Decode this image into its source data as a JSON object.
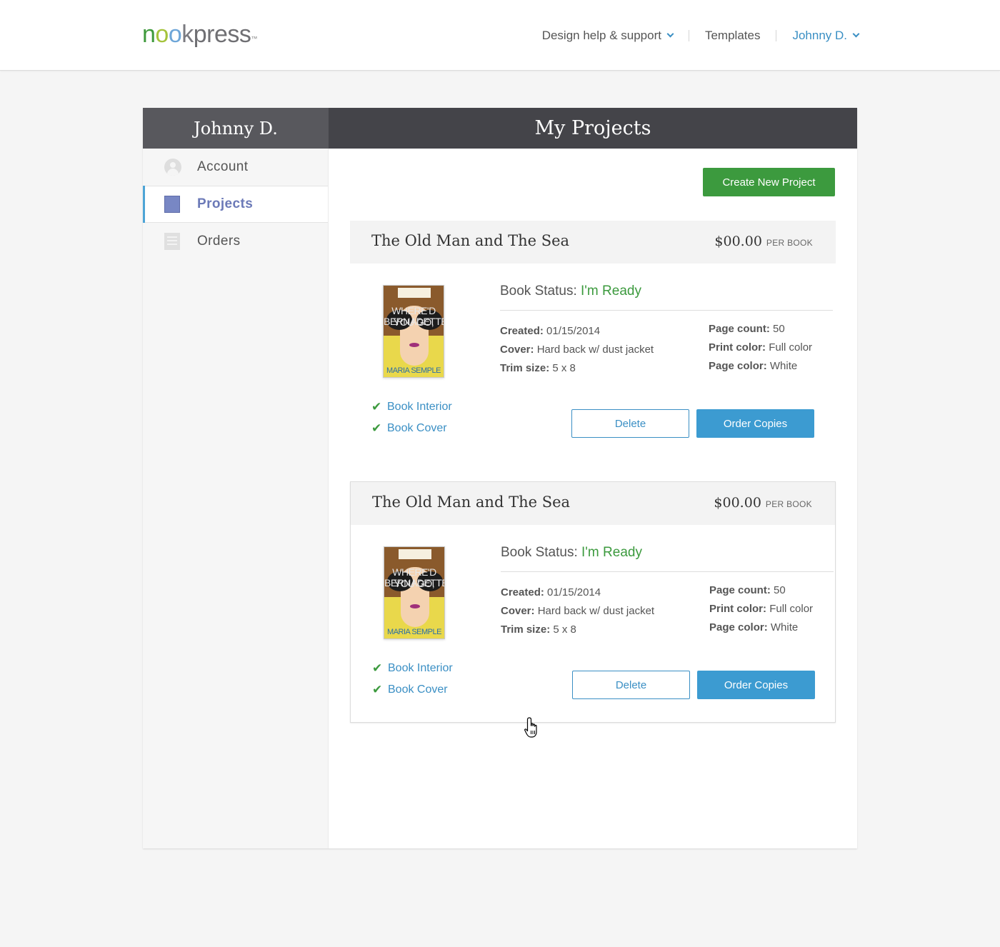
{
  "header": {
    "logo": {
      "nook_n": "n",
      "nook_o1": "o",
      "nook_o2": "o",
      "nook_k": "k",
      "press": "press",
      "tm": "™"
    },
    "nav": {
      "help_label": "Design help & support",
      "templates_label": "Templates",
      "user_label": "Johnny D."
    }
  },
  "sidebar": {
    "user_name": "Johnny D.",
    "items": [
      {
        "label": "Account",
        "icon": "user-icon"
      },
      {
        "label": "Projects",
        "icon": "book-icon",
        "active": true
      },
      {
        "label": "Orders",
        "icon": "receipt-icon"
      }
    ]
  },
  "main": {
    "title": "My Projects",
    "create_button": "Create New Project",
    "projects": [
      {
        "title": "The Old Man and The Sea",
        "price": "$00.00",
        "price_unit": "PER BOOK",
        "status_label": "Book Status:",
        "status_value": "I'm Ready",
        "created_label": "Created:",
        "created": "01/15/2014",
        "cover_label": "Cover:",
        "cover": "Hard back w/ dust jacket",
        "trim_label": "Trim size:",
        "trim": "5 x 8",
        "pages_label": "Page count:",
        "pages": "50",
        "print_label": "Print color:",
        "print": "Full color",
        "pagecolor_label": "Page color:",
        "pagecolor": "White",
        "checks": [
          "Book Interior",
          "Book Cover"
        ],
        "delete_button": "Delete",
        "order_button": "Order Copies",
        "book_cover": {
          "title_line1": "WHERE'D YOU GO,",
          "title_line2": "BERNADETTE",
          "author": "MARIA SEMPLE"
        }
      },
      {
        "title": "The Old Man and The Sea",
        "price": "$00.00",
        "price_unit": "PER BOOK",
        "status_label": "Book Status:",
        "status_value": "I'm Ready",
        "created_label": "Created:",
        "created": "01/15/2014",
        "cover_label": "Cover:",
        "cover": "Hard back w/ dust jacket",
        "trim_label": "Trim size:",
        "trim": "5 x 8",
        "pages_label": "Page count:",
        "pages": "50",
        "print_label": "Print color:",
        "print": "Full color",
        "pagecolor_label": "Page color:",
        "pagecolor": "White",
        "checks": [
          "Book Interior",
          "Book Cover"
        ],
        "delete_button": "Delete",
        "order_button": "Order Copies",
        "book_cover": {
          "title_line1": "WHERE'D YOU GO,",
          "title_line2": "BERNADETTE",
          "author": "MARIA SEMPLE"
        }
      }
    ]
  },
  "colors": {
    "accent_green": "#3c9a3e",
    "accent_blue": "#3a8fc4",
    "header_dark": "#444449",
    "sidebar_active": "#6c7ab8"
  }
}
